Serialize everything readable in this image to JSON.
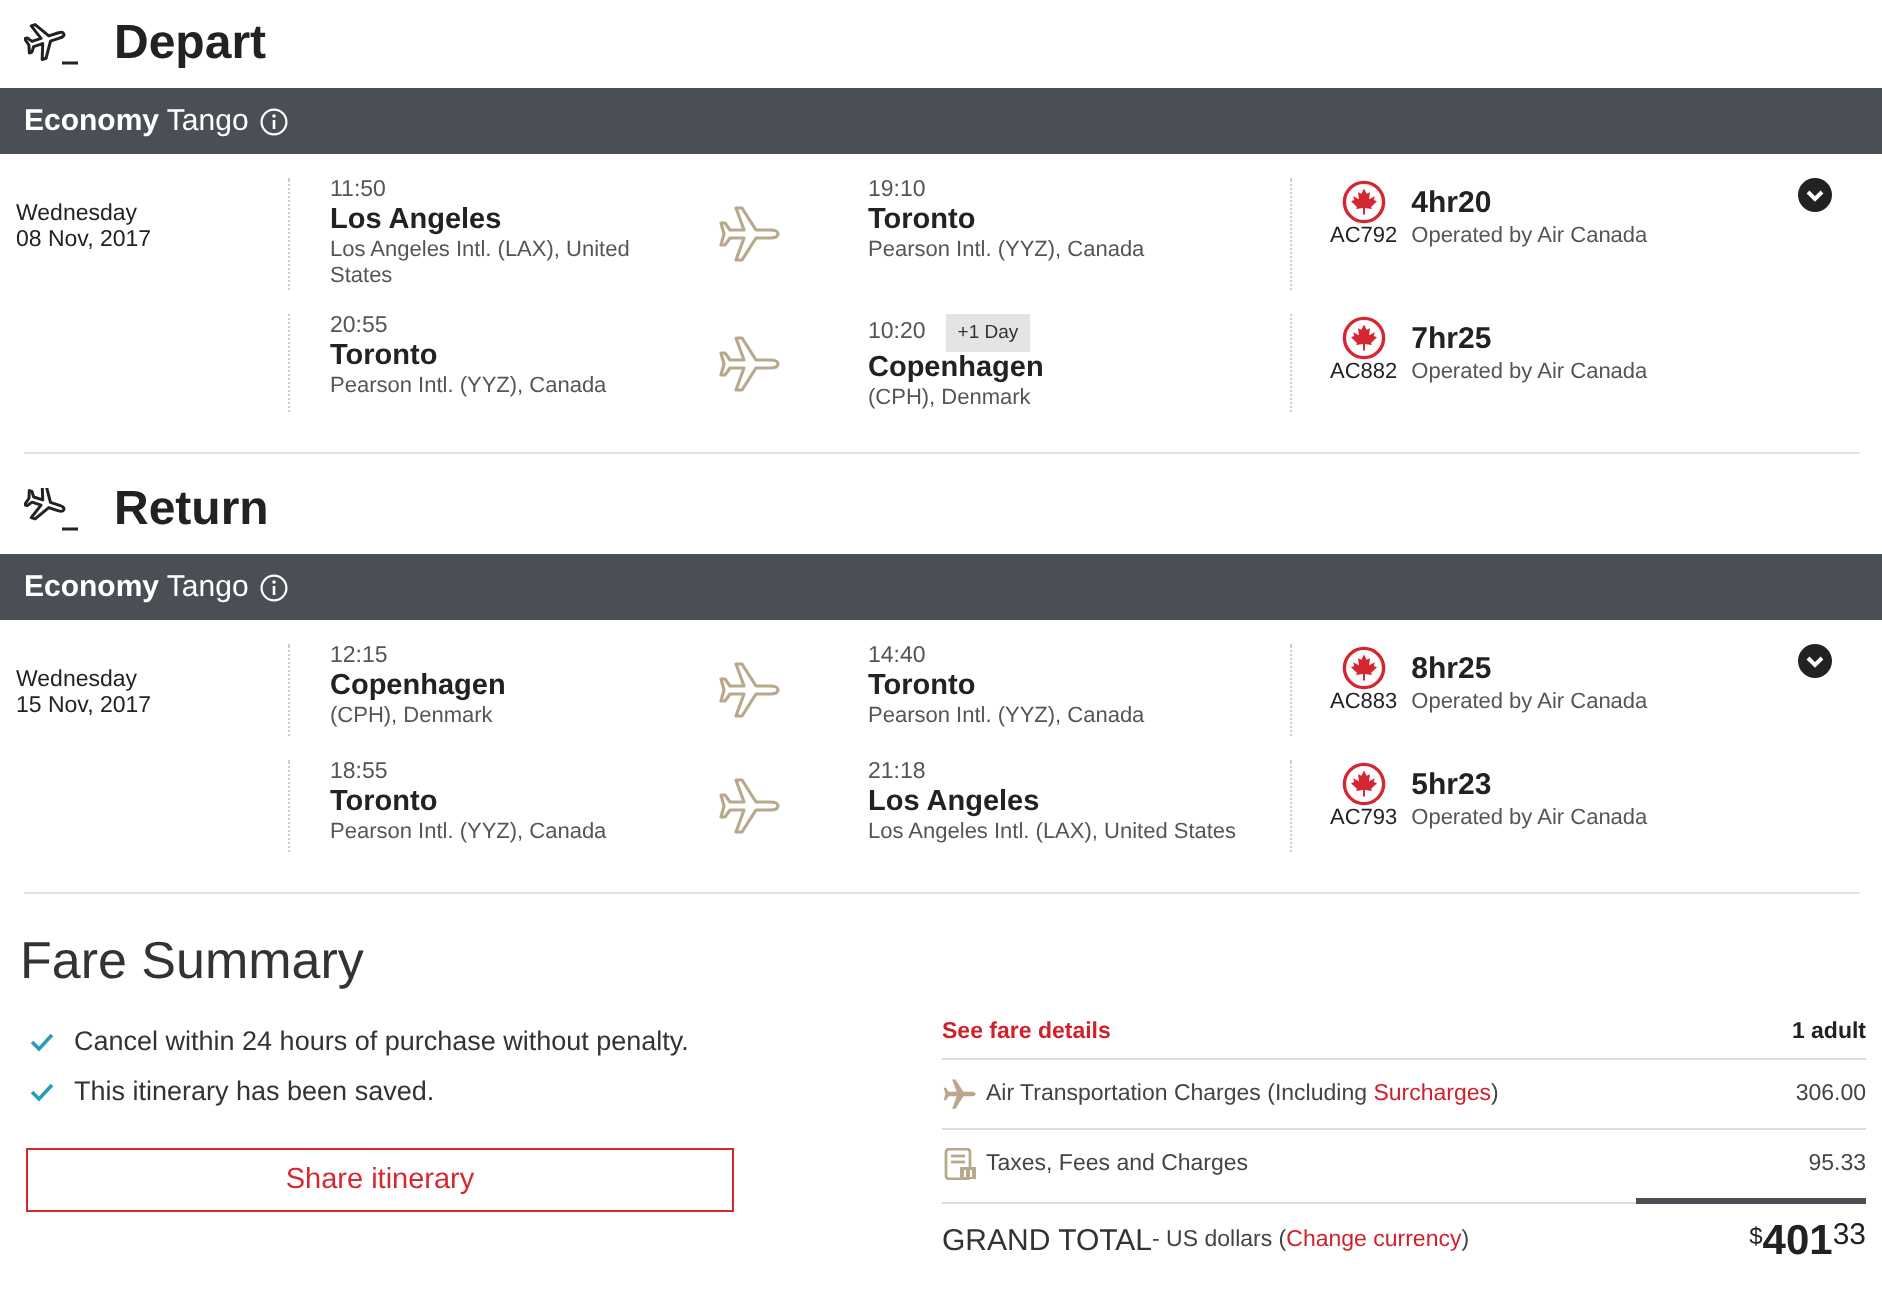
{
  "sections": [
    {
      "kind": "depart",
      "title": "Depart",
      "cabin": "**Economy** Tango",
      "weekday": "Wednesday",
      "date": "08 Nov, 2017",
      "segments": [
        {
          "depart": {
            "time": "11:50",
            "city": "Los Angeles",
            "airport": "Los Angeles Intl. (LAX), United States"
          },
          "arrive": {
            "time": "19:10",
            "city": "Toronto",
            "airport": "Pearson Intl. (YYZ), Canada"
          },
          "flight": "AC792",
          "duration": "4hr20",
          "operator": "Operated by Air Canada"
        },
        {
          "depart": {
            "time": "20:55",
            "city": "Toronto",
            "airport": "Pearson Intl. (YYZ), Canada"
          },
          "arrive": {
            "time": "10:20",
            "day_offset": "+1 Day",
            "city": "Copenhagen",
            "airport": "(CPH), Denmark"
          },
          "flight": "AC882",
          "duration": "7hr25",
          "operator": "Operated by Air Canada"
        }
      ]
    },
    {
      "kind": "return",
      "title": "Return",
      "cabin": "**Economy** Tango",
      "weekday": "Wednesday",
      "date": "15 Nov, 2017",
      "segments": [
        {
          "depart": {
            "time": "12:15",
            "city": "Copenhagen",
            "airport": "(CPH), Denmark"
          },
          "arrive": {
            "time": "14:40",
            "city": "Toronto",
            "airport": "Pearson Intl. (YYZ), Canada"
          },
          "flight": "AC883",
          "duration": "8hr25",
          "operator": "Operated by Air Canada"
        },
        {
          "depart": {
            "time": "18:55",
            "city": "Toronto",
            "airport": "Pearson Intl. (YYZ), Canada"
          },
          "arrive": {
            "time": "21:18",
            "city": "Los Angeles",
            "airport": "Los Angeles Intl. (LAX), United States"
          },
          "flight": "AC793",
          "duration": "5hr23",
          "operator": "Operated by Air Canada"
        }
      ]
    }
  ],
  "fare_summary": {
    "title": "Fare Summary",
    "notes": [
      "Cancel within 24 hours of purchase without penalty.",
      "This itinerary has been saved."
    ],
    "share_button": "Share itinerary",
    "details_link": "See fare details",
    "passengers": "1 adult",
    "charges": [
      {
        "kind": "air",
        "text": "Air Transportation Charges (Including ",
        "link": "Surcharges",
        "text_after": ")",
        "amount": "306.00"
      },
      {
        "kind": "taxes",
        "text": "Taxes, Fees and Charges",
        "amount": "95.33"
      }
    ],
    "grand_total": {
      "label": "GRAND TOTAL",
      "note": "- US dollars (",
      "link": "Change currency",
      "note_after": ")",
      "symbol": "$",
      "whole": "401",
      "cents": "33"
    }
  }
}
